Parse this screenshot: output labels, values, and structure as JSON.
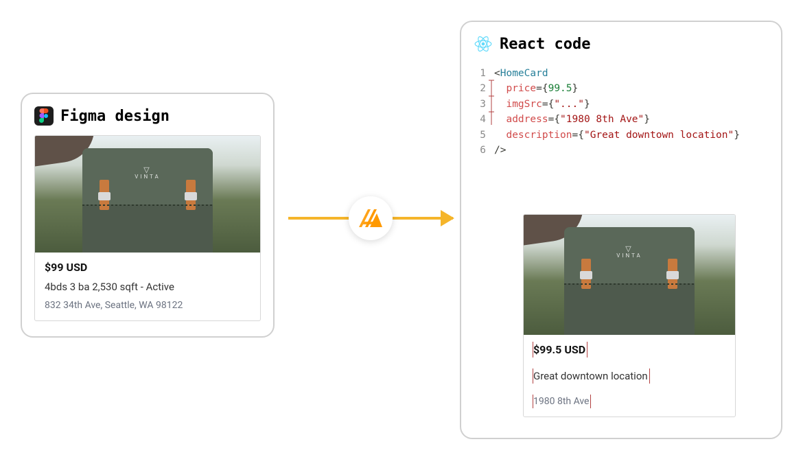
{
  "left": {
    "title": "Figma design",
    "card": {
      "price": "$99 USD",
      "description": "4bds 3 ba 2,530 sqft - Active",
      "address": "832 34th Ave, Seattle, WA 98122",
      "image_brand": "VINTA"
    }
  },
  "right": {
    "title": "React code",
    "code": {
      "component": "HomeCard",
      "line1_open": "<HomeCard",
      "attr_price": "price",
      "val_price": "99.5",
      "attr_imgSrc": "imgSrc",
      "val_imgSrc": "\"...\"",
      "attr_address": "address",
      "val_address": "\"1980 8th Ave\"",
      "attr_description": "description",
      "val_description": "\"Great downtown location\"",
      "close": "/>",
      "ln1": "1",
      "ln2": "2",
      "ln3": "3",
      "ln4": "4",
      "ln5": "5",
      "ln6": "6"
    },
    "rendered": {
      "price": "$99.5 USD",
      "description": "Great downtown location",
      "address": "1980 8th Ave",
      "image_brand": "VINTA"
    }
  },
  "icons": {
    "figma": "figma-icon",
    "react": "react-icon",
    "amplify": "amplify-icon"
  }
}
